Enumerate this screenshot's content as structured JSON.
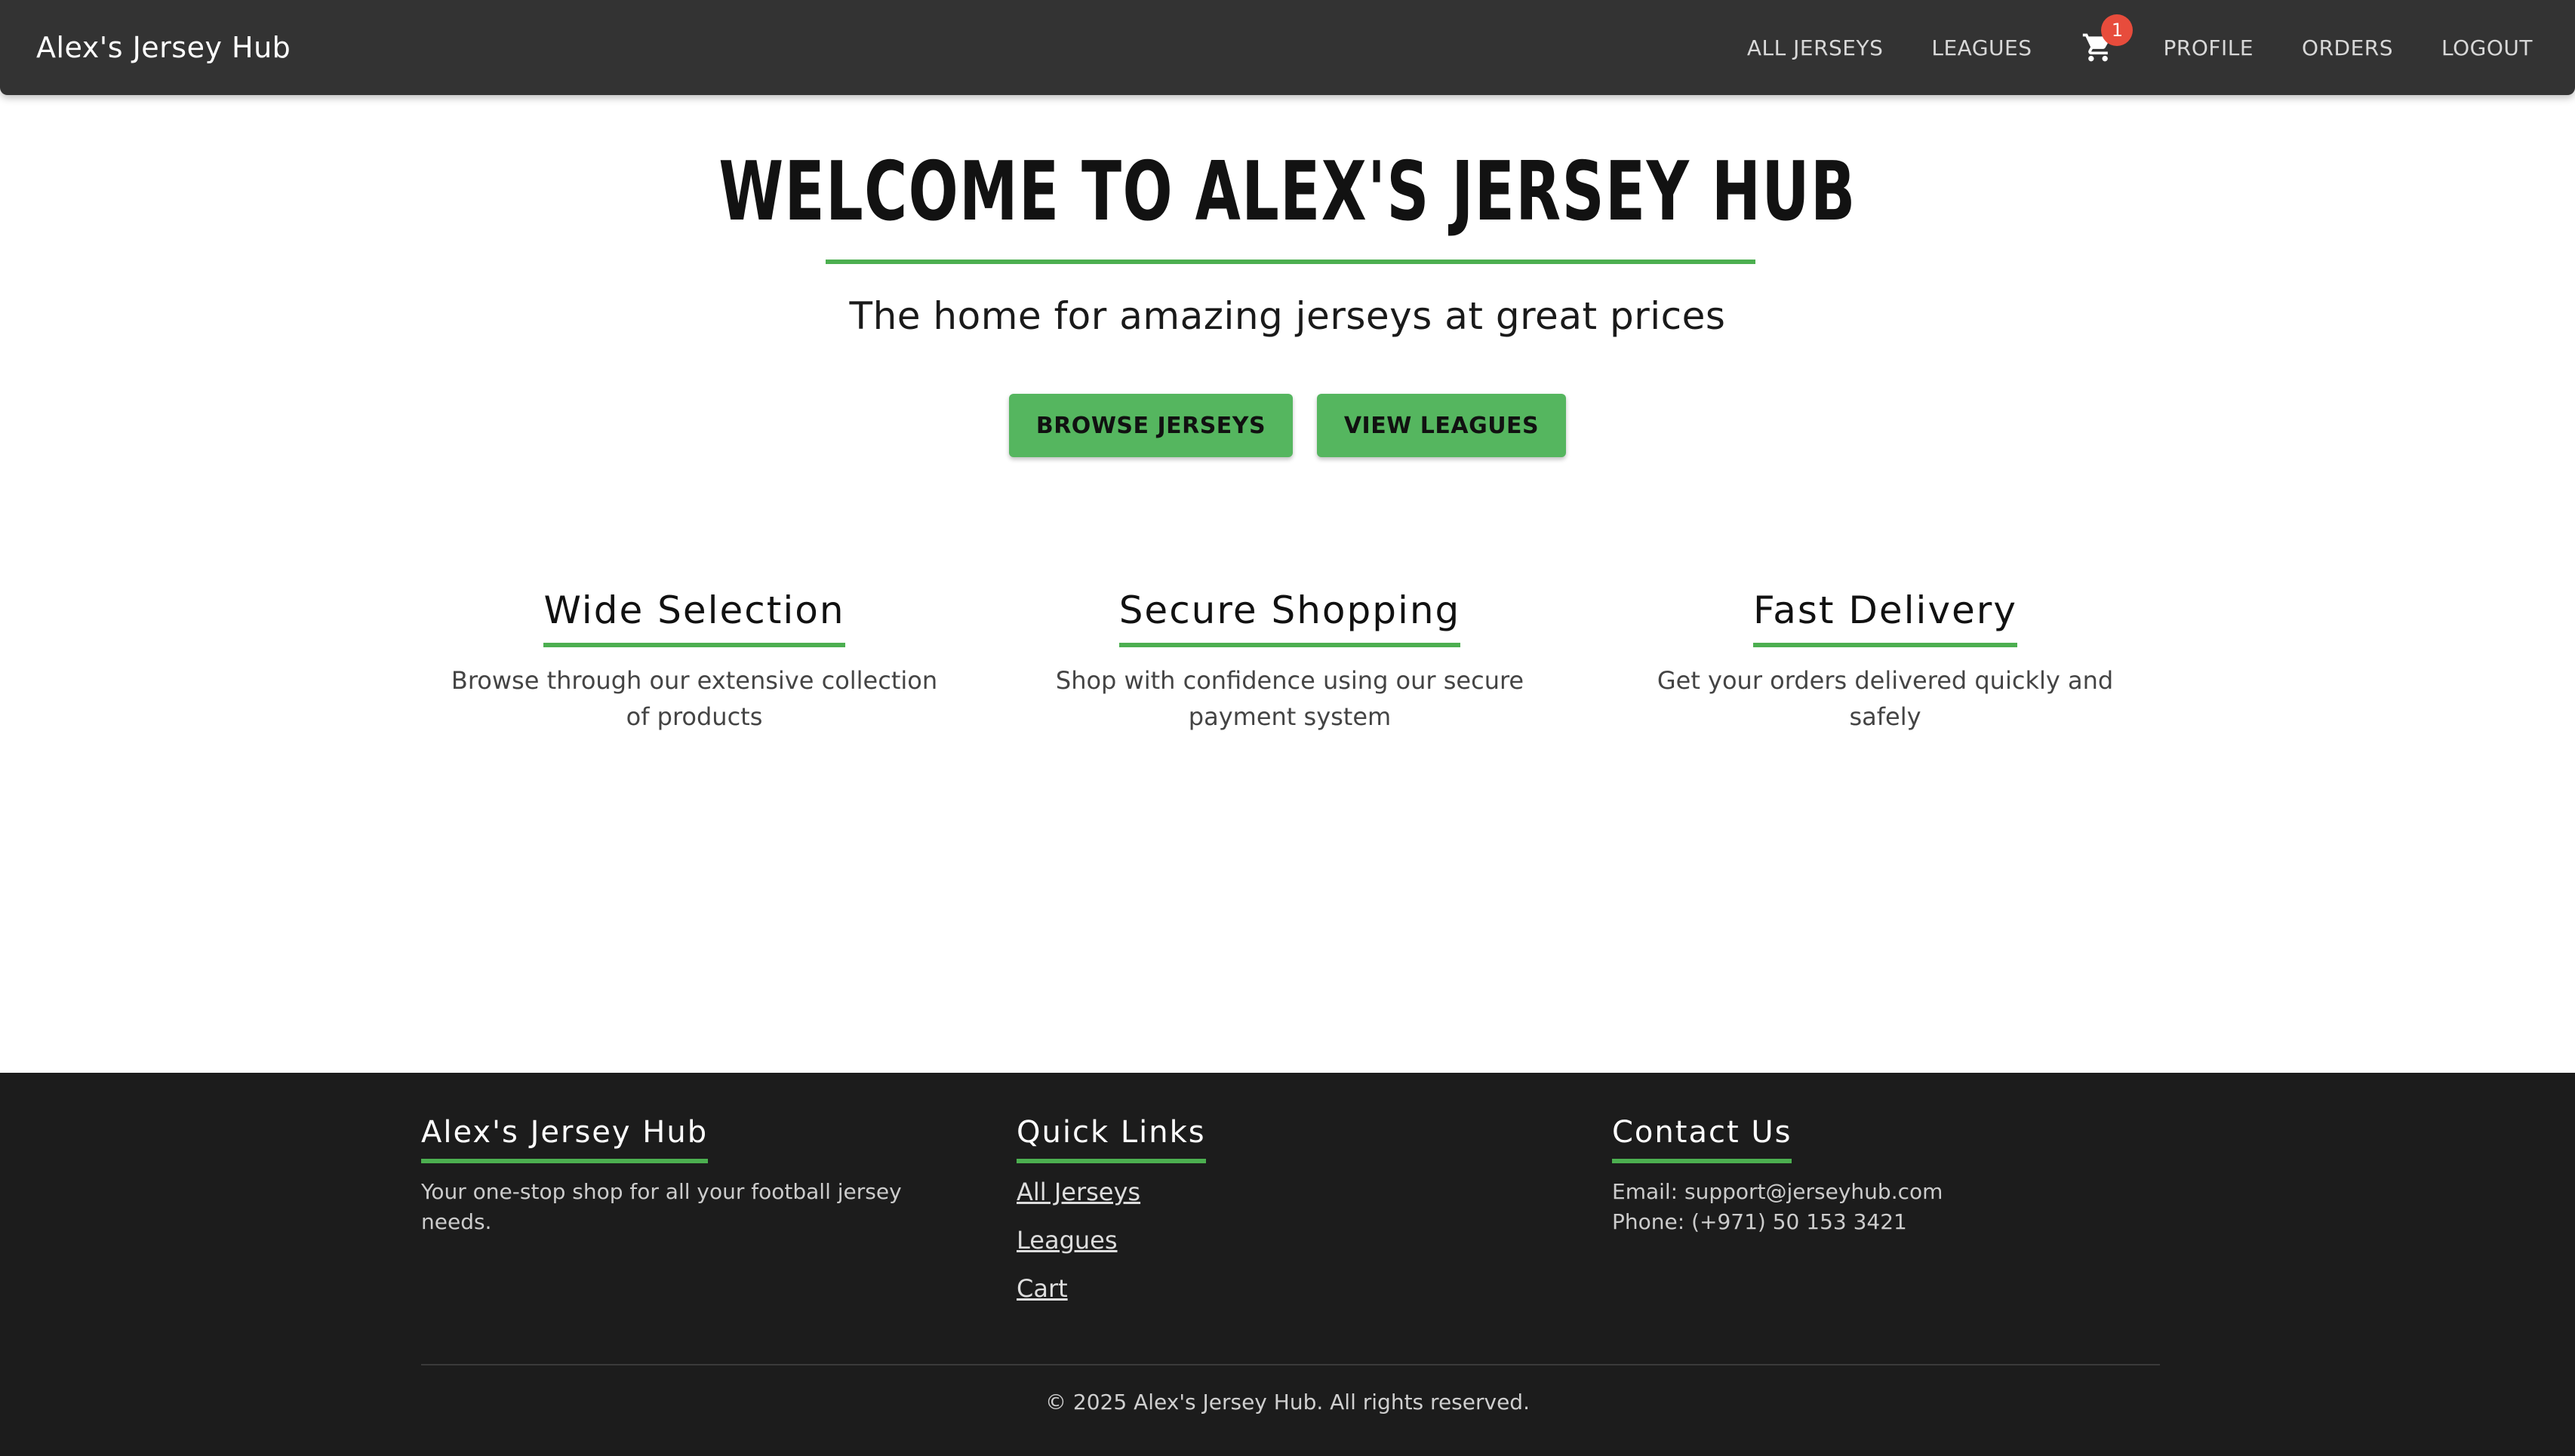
{
  "navbar": {
    "brand": "Alex's Jersey Hub",
    "links": [
      "ALL JERSEYS",
      "LEAGUES",
      "PROFILE",
      "ORDERS",
      "LOGOUT"
    ],
    "cart_icon": "shopping-cart-icon",
    "cart_count": "1"
  },
  "hero": {
    "title": "WELCOME TO ALEX'S JERSEY HUB",
    "subtitle": "The home for amazing jerseys at great prices",
    "buttons": {
      "browse": "BROWSE JERSEYS",
      "leagues": "VIEW LEAGUES"
    }
  },
  "features": [
    {
      "title": "Wide Selection",
      "description": "Browse through our extensive collection of products"
    },
    {
      "title": "Secure Shopping",
      "description": "Shop with confidence using our secure payment system"
    },
    {
      "title": "Fast Delivery",
      "description": "Get your orders delivered quickly and safely"
    }
  ],
  "footer": {
    "about": {
      "heading": "Alex's Jersey Hub",
      "text": "Your one-stop shop for all your football jersey needs."
    },
    "quick_links": {
      "heading": "Quick Links",
      "links": [
        "All Jerseys",
        "Leagues",
        "Cart"
      ]
    },
    "contact": {
      "heading": "Contact Us",
      "email": "Email: support@jerseyhub.com",
      "phone": "Phone: (+971) 50 153 3421"
    },
    "copyright": "© 2025 Alex's Jersey Hub. All rights reserved."
  },
  "colors": {
    "accent": "#4caf50",
    "button": "#55b65f",
    "navbar": "#333333",
    "footer": "#1c1c1c",
    "badge": "#e74c3c"
  }
}
